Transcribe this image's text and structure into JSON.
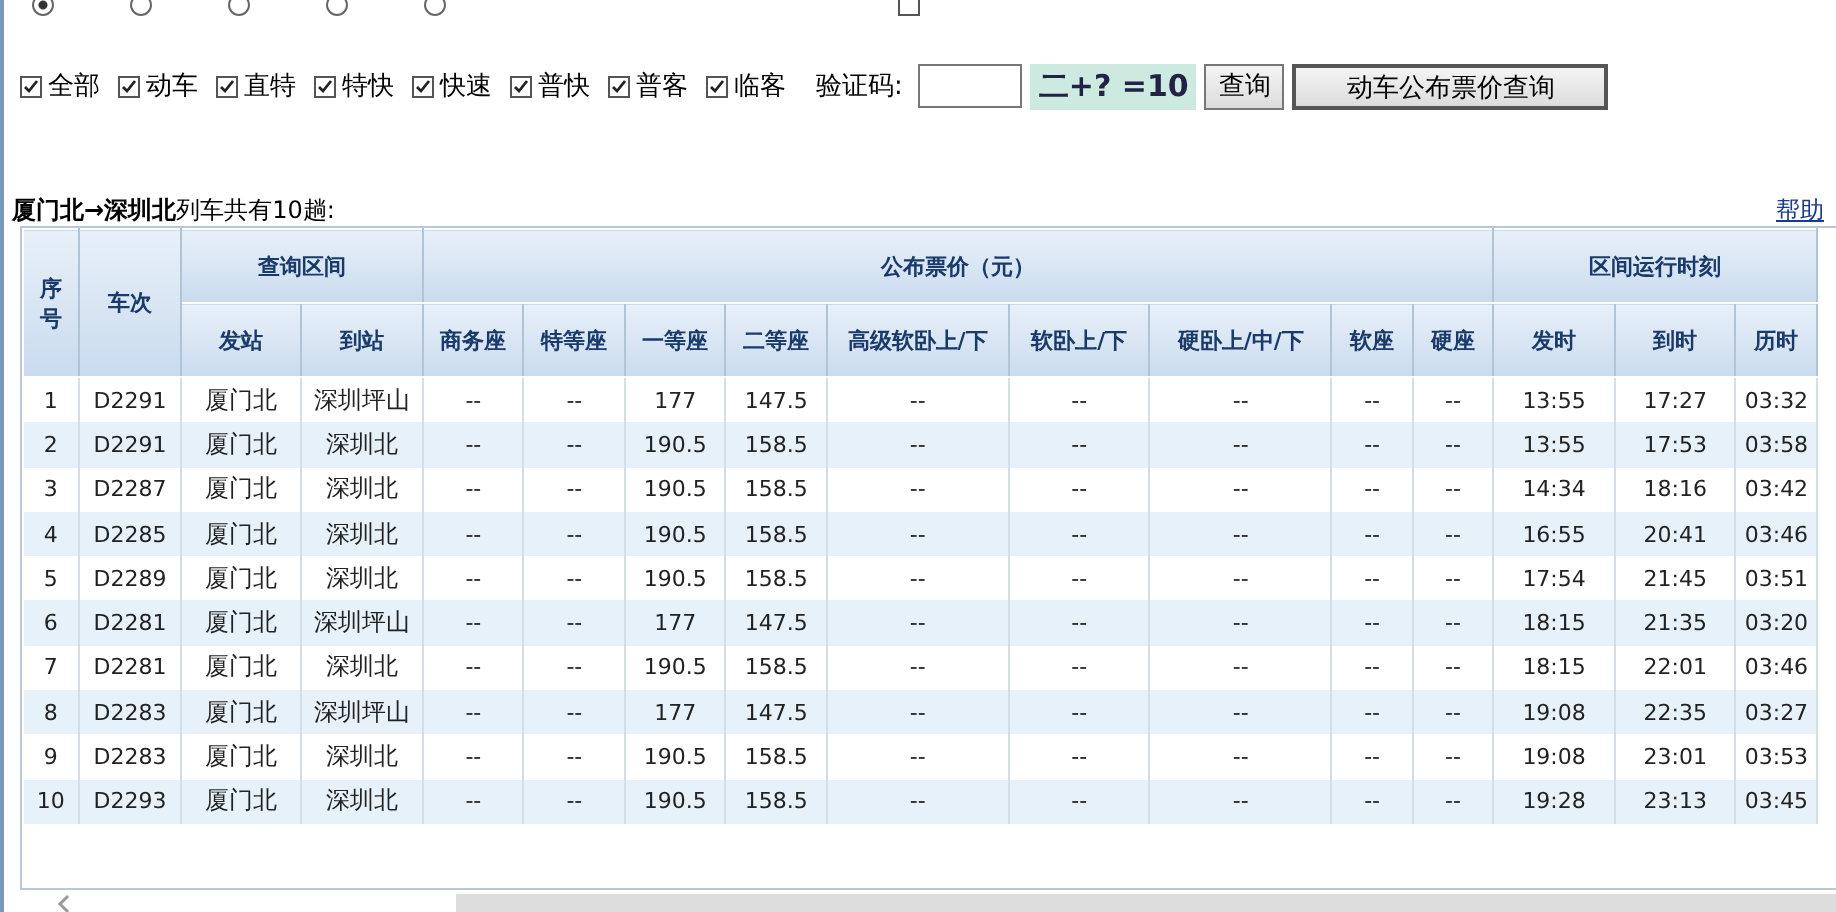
{
  "radio_row": {
    "options": [
      {
        "selected": true
      },
      {
        "selected": false
      },
      {
        "selected": false
      },
      {
        "selected": false
      },
      {
        "selected": false
      }
    ],
    "checkbox": {
      "checked": false
    }
  },
  "filters": [
    {
      "label": "全部",
      "checked": true
    },
    {
      "label": "动车",
      "checked": true
    },
    {
      "label": "直特",
      "checked": true
    },
    {
      "label": "特快",
      "checked": true
    },
    {
      "label": "快速",
      "checked": true
    },
    {
      "label": "普快",
      "checked": true
    },
    {
      "label": "普客",
      "checked": true
    },
    {
      "label": "临客",
      "checked": true
    }
  ],
  "captcha": {
    "label": "验证码:",
    "image_text": "二+? =10"
  },
  "buttons": [
    "查询",
    "动车公布票价查询"
  ],
  "result_title": "**厦门北→深圳北**列车共有10趟:",
  "help_link": "帮助",
  "table": {
    "columns": [
      "序号",
      "车次"
    ],
    "column_groups": [
      {
        "label": "查询区间",
        "columns": [
          "发站",
          "到站"
        ]
      },
      {
        "label": "公布票价（元）",
        "columns": [
          "商务座",
          "特等座",
          "一等座",
          "二等座",
          "高级软卧上/下",
          "软卧上/下",
          "硬卧上/中/下",
          "软座",
          "硬座"
        ]
      },
      {
        "label": "区间运行时刻",
        "columns": [
          "发时",
          "到时",
          "历时"
        ]
      }
    ],
    "rows": [
      [
        "1",
        "D2291",
        "厦门北",
        "深圳坪山",
        "--",
        "--",
        "177",
        "147.5",
        "--",
        "--",
        "--",
        "--",
        "--",
        "13:55",
        "17:27",
        "03:32"
      ],
      [
        "2",
        "D2291",
        "厦门北",
        "深圳北",
        "--",
        "--",
        "190.5",
        "158.5",
        "--",
        "--",
        "--",
        "--",
        "--",
        "13:55",
        "17:53",
        "03:58"
      ],
      [
        "3",
        "D2287",
        "厦门北",
        "深圳北",
        "--",
        "--",
        "190.5",
        "158.5",
        "--",
        "--",
        "--",
        "--",
        "--",
        "14:34",
        "18:16",
        "03:42"
      ],
      [
        "4",
        "D2285",
        "厦门北",
        "深圳北",
        "--",
        "--",
        "190.5",
        "158.5",
        "--",
        "--",
        "--",
        "--",
        "--",
        "16:55",
        "20:41",
        "03:46"
      ],
      [
        "5",
        "D2289",
        "厦门北",
        "深圳北",
        "--",
        "--",
        "190.5",
        "158.5",
        "--",
        "--",
        "--",
        "--",
        "--",
        "17:54",
        "21:45",
        "03:51"
      ],
      [
        "6",
        "D2281",
        "厦门北",
        "深圳坪山",
        "--",
        "--",
        "177",
        "147.5",
        "--",
        "--",
        "--",
        "--",
        "--",
        "18:15",
        "21:35",
        "03:20"
      ],
      [
        "7",
        "D2281",
        "厦门北",
        "深圳北",
        "--",
        "--",
        "190.5",
        "158.5",
        "--",
        "--",
        "--",
        "--",
        "--",
        "18:15",
        "22:01",
        "03:46"
      ],
      [
        "8",
        "D2283",
        "厦门北",
        "深圳坪山",
        "--",
        "--",
        "177",
        "147.5",
        "--",
        "--",
        "--",
        "--",
        "--",
        "19:08",
        "22:35",
        "03:27"
      ],
      [
        "9",
        "D2283",
        "厦门北",
        "深圳北",
        "--",
        "--",
        "190.5",
        "158.5",
        "--",
        "--",
        "--",
        "--",
        "--",
        "19:08",
        "23:01",
        "03:53"
      ],
      [
        "10",
        "D2293",
        "厦门北",
        "深圳北",
        "--",
        "--",
        "190.5",
        "158.5",
        "--",
        "--",
        "--",
        "--",
        "--",
        "19:28",
        "23:13",
        "03:45"
      ]
    ]
  }
}
